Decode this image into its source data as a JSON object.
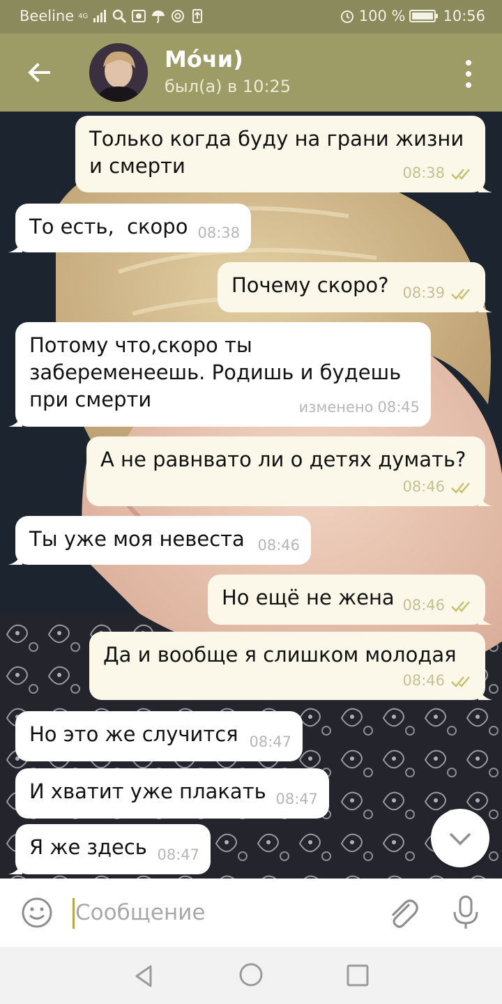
{
  "status_bar": {
    "carrier": "Beeline",
    "network": "4G",
    "battery": "100 %",
    "time": "10:56"
  },
  "header": {
    "contact_name": "Мо́чи)",
    "last_seen": "был(а) в 10:25"
  },
  "messages": [
    {
      "direction": "out",
      "text": "Только когда буду на грани жизни\nи смерти",
      "time": "08:38",
      "read": true
    },
    {
      "direction": "in",
      "text": "То есть,  скоро",
      "time": "08:38"
    },
    {
      "direction": "out",
      "text": "Почему скоро?",
      "time": "08:39",
      "read": true
    },
    {
      "direction": "in",
      "text": "Потому что,скоро ты\nзабеременеешь. Родишь и будешь\nпри смерти",
      "time": "08:45",
      "edited_label": "изменено"
    },
    {
      "direction": "out",
      "text": "А не равнвато ли о детях думать?",
      "time": "08:46",
      "read": true
    },
    {
      "direction": "in",
      "text": "Ты уже моя невеста",
      "time": "08:46"
    },
    {
      "direction": "out",
      "text": "Но ещё не жена",
      "time": "08:46",
      "read": true
    },
    {
      "direction": "out",
      "text": "Да и вообще я слишком молодая",
      "time": "08:46",
      "read": true
    },
    {
      "direction": "in",
      "text": "Но это же случится",
      "time": "08:47"
    },
    {
      "direction": "in",
      "text": "И хватит уже плакать",
      "time": "08:47"
    },
    {
      "direction": "in",
      "text": "Я же здесь",
      "time": "08:47"
    }
  ],
  "composer": {
    "placeholder": "Сообщение"
  },
  "colors": {
    "header": "#9d9b66",
    "status_bar": "#8b8a5c",
    "incoming_bubble": "#ffffff",
    "outgoing_bubble": "#fbf8ea",
    "read_ticks": "#c9bf6e",
    "caret": "#b5a64a"
  },
  "icons": [
    "back-arrow-icon",
    "more-vert-icon",
    "emoji-icon",
    "attach-icon",
    "mic-icon",
    "chevron-down-icon",
    "double-check-icon"
  ]
}
